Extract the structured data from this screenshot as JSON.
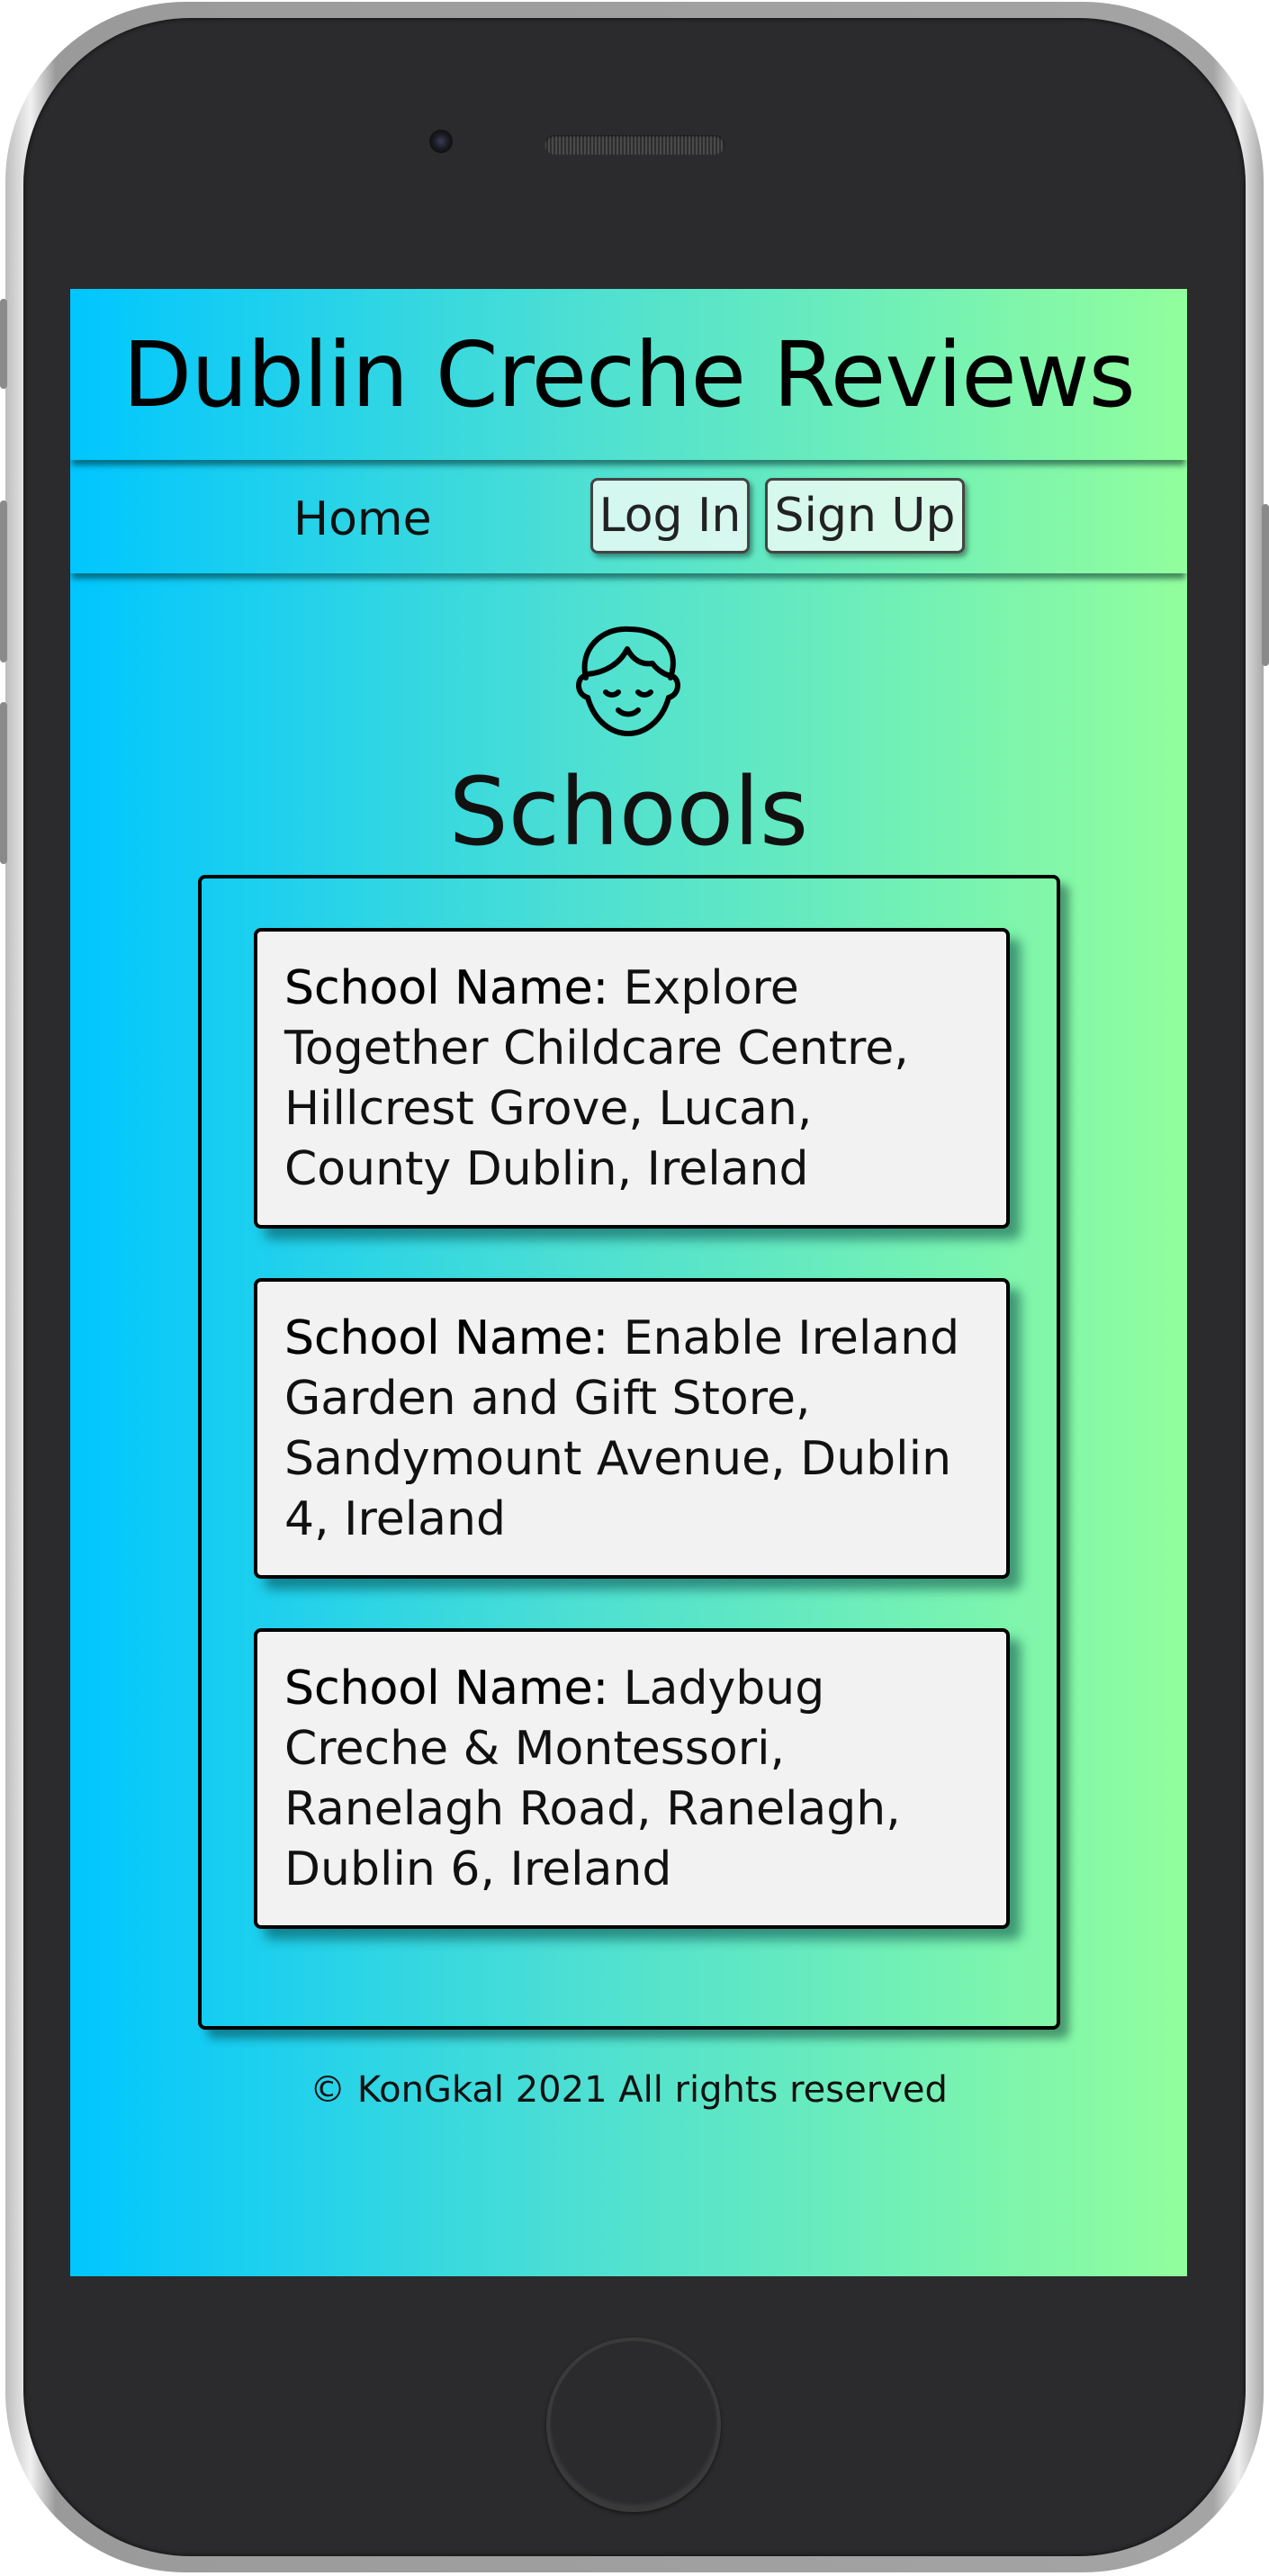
{
  "header": {
    "title": "Dublin Creche Reviews"
  },
  "nav": {
    "home_label": "Home",
    "login_label": "Log In",
    "signup_label": "Sign Up"
  },
  "page": {
    "heading": "Schools",
    "avatar_icon": "child-face-icon"
  },
  "schools": [
    {
      "label": "School Name:",
      "value": "Explore Together Childcare Centre, Hillcrest Grove, Lucan, County Dublin, Ireland"
    },
    {
      "label": "School Name:",
      "value": "Enable Ireland Garden and Gift Store, Sandymount Avenue, Dublin 4, Ireland"
    },
    {
      "label": "School Name:",
      "value": "Ladybug Creche & Montessori, Ranelagh Road, Ranelagh, Dublin 6, Ireland"
    }
  ],
  "footer": {
    "text": "© KonGkal 2021 All rights reserved"
  },
  "colors": {
    "gradient_start": "#00c6ff",
    "gradient_end": "#92fe9d",
    "card_bg": "#f2f2f2"
  }
}
